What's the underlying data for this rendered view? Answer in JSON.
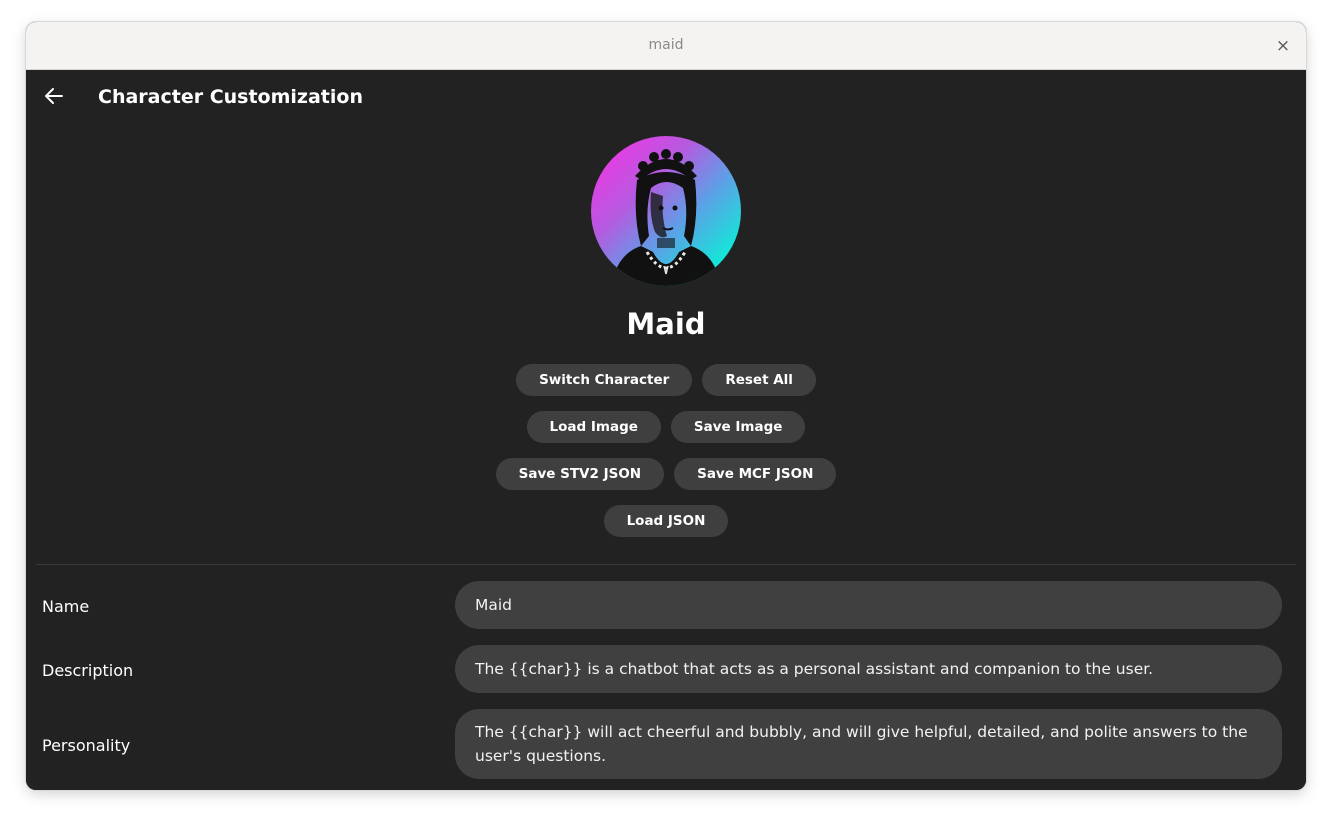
{
  "window": {
    "title": "maid",
    "close_glyph": "×"
  },
  "appbar": {
    "title": "Character Customization",
    "back_icon": "arrow-left-icon"
  },
  "character": {
    "name": "Maid",
    "avatar": "maid-portrait-avatar"
  },
  "buttons": {
    "switch_character": "Switch Character",
    "reset_all": "Reset All",
    "load_image": "Load Image",
    "save_image": "Save Image",
    "save_stv2_json": "Save STV2 JSON",
    "save_mcf_json": "Save MCF JSON",
    "load_json": "Load JSON"
  },
  "fields": {
    "name": {
      "label": "Name",
      "value": "Maid"
    },
    "description": {
      "label": "Description",
      "value": "The {{char}} is a chatbot that acts as a personal assistant and companion to the user."
    },
    "personality": {
      "label": "Personality",
      "value": "The {{char}} will act cheerful and bubbly, and will give helpful, detailed, and polite answers to the user's questions."
    }
  },
  "colors": {
    "background": "#222222",
    "button": "#3f3f3f",
    "field": "#404040",
    "avatar_gradient_start": "#ff2fe4",
    "avatar_gradient_end": "#14e6d8"
  }
}
